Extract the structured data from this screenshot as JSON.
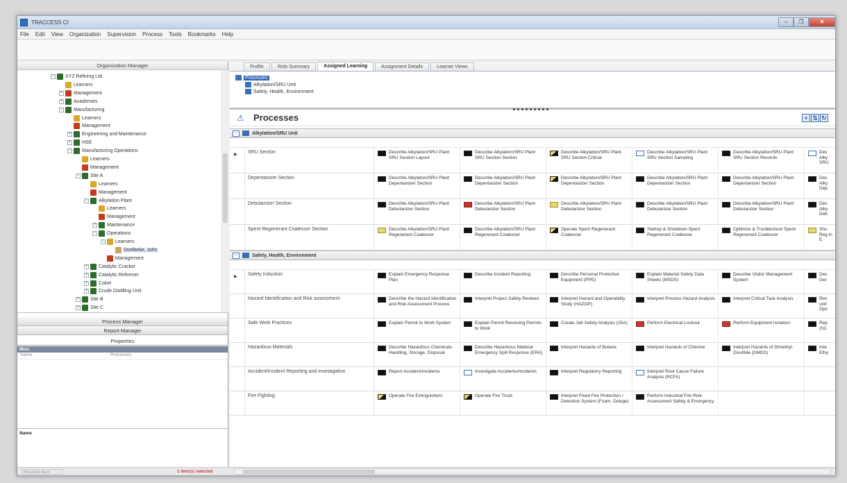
{
  "window": {
    "title": "TRACCESS CI",
    "controls": [
      "–",
      "❐",
      "✕"
    ]
  },
  "menu": [
    "File",
    "Edit",
    "View",
    "Organization",
    "Supervision",
    "Process",
    "Tools",
    "Bookmarks",
    "Help"
  ],
  "left_pane": {
    "header": "Organization Manager",
    "tree": [
      {
        "label": "XYZ Refining Ltd",
        "icon": "org",
        "depth": 0,
        "exp": "−"
      },
      {
        "label": "Learners",
        "icon": "grp",
        "depth": 1,
        "exp": ""
      },
      {
        "label": "Management",
        "icon": "mgr",
        "depth": 1,
        "exp": "+"
      },
      {
        "label": "Academies",
        "icon": "org",
        "depth": 1,
        "exp": "+"
      },
      {
        "label": "Manufacturing",
        "icon": "org",
        "depth": 1,
        "exp": "−"
      },
      {
        "label": "Learners",
        "icon": "grp",
        "depth": 2,
        "exp": ""
      },
      {
        "label": "Management",
        "icon": "mgr",
        "depth": 2,
        "exp": ""
      },
      {
        "label": "Engineering and Maintenance",
        "icon": "org",
        "depth": 2,
        "exp": "+"
      },
      {
        "label": "HSE",
        "icon": "org",
        "depth": 2,
        "exp": "+"
      },
      {
        "label": "Manufacturing Operations",
        "icon": "org",
        "depth": 2,
        "exp": "−"
      },
      {
        "label": "Learners",
        "icon": "grp",
        "depth": 3,
        "exp": ""
      },
      {
        "label": "Management",
        "icon": "mgr",
        "depth": 3,
        "exp": ""
      },
      {
        "label": "Site A",
        "icon": "org",
        "depth": 3,
        "exp": "−"
      },
      {
        "label": "Learners",
        "icon": "grp",
        "depth": 4,
        "exp": ""
      },
      {
        "label": "Management",
        "icon": "mgr",
        "depth": 4,
        "exp": ""
      },
      {
        "label": "Alkylation Plant",
        "icon": "org",
        "depth": 4,
        "exp": "−"
      },
      {
        "label": "Learners",
        "icon": "grp",
        "depth": 5,
        "exp": ""
      },
      {
        "label": "Management",
        "icon": "mgr",
        "depth": 5,
        "exp": ""
      },
      {
        "label": "Maintenance",
        "icon": "org",
        "depth": 5,
        "exp": "+"
      },
      {
        "label": "Operations",
        "icon": "org",
        "depth": 5,
        "exp": "−"
      },
      {
        "label": "Learners",
        "icon": "grp",
        "depth": 6,
        "exp": "−"
      },
      {
        "label": "Doelbeke, John",
        "icon": "user",
        "depth": 7,
        "exp": "",
        "selected": true
      },
      {
        "label": "Management",
        "icon": "mgr",
        "depth": 6,
        "exp": ""
      },
      {
        "label": "Catalytic Cracker",
        "icon": "org",
        "depth": 4,
        "exp": "+"
      },
      {
        "label": "Catalytic Reformer",
        "icon": "org",
        "depth": 4,
        "exp": "+"
      },
      {
        "label": "Coker",
        "icon": "org",
        "depth": 4,
        "exp": "+"
      },
      {
        "label": "Crude Distilling Unit",
        "icon": "org",
        "depth": 4,
        "exp": "+"
      },
      {
        "label": "Site B",
        "icon": "org",
        "depth": 3,
        "exp": "+"
      },
      {
        "label": "Site C",
        "icon": "org",
        "depth": 3,
        "exp": "+"
      }
    ],
    "process_manager": "Process Manager",
    "report_manager": "Report Manager",
    "properties": "Properties",
    "props_section": "Misc",
    "props_row": {
      "name": "Name",
      "value": "Processes"
    },
    "desc_label": "Name",
    "status_left": "Resolve Item",
    "status_right": "1 item(s) selected"
  },
  "tabs": [
    {
      "label": "Profile",
      "active": false
    },
    {
      "label": "Role Summary",
      "active": false
    },
    {
      "label": "Assigned Learning",
      "active": true
    },
    {
      "label": "Assignment Details",
      "active": false
    },
    {
      "label": "Learner Views",
      "active": false
    }
  ],
  "crumb_tree": {
    "root": "Processes",
    "children": [
      "Alkylation/SRU Unit",
      "Safety, Health, Environment"
    ]
  },
  "processes": {
    "title": "Processes",
    "buttons": [
      "+",
      "⇅",
      "↻"
    ],
    "groups": [
      {
        "label": "Alkylation/SRU Unit",
        "rows": [
          {
            "section": "SRU Section",
            "current": true,
            "cells": [
              {
                "ico": "black",
                "text": "Describe Alkylation/SRU Plant SRU Section Layout"
              },
              {
                "ico": "black",
                "text": "Describe Alkylation/SRU Plant SRU Section Section"
              },
              {
                "ico": "flag",
                "text": "Describe Alkylation/SRU Plant SRU Section Critical"
              },
              {
                "ico": "white",
                "text": "Describe Alkylation/SRU Plant SRU Section Sampling"
              },
              {
                "ico": "black",
                "text": "Describe Alkylation/SRU Plant SRU Section Records"
              },
              {
                "ico": "white",
                "text": "Des Alky SRU"
              }
            ]
          },
          {
            "section": "Depentanizer Section",
            "cells": [
              {
                "ico": "black",
                "text": "Describe Alkylation/SRU Plant Depentanizer Section"
              },
              {
                "ico": "black",
                "text": "Describe Alkylation/SRU Plant Depentanizer Section"
              },
              {
                "ico": "flag",
                "text": "Describe Alkylation/SRU Plant Depentanizer Section"
              },
              {
                "ico": "black",
                "text": "Describe Alkylation/SRU Plant Depentanizer Section"
              },
              {
                "ico": "black",
                "text": "Describe Alkylation/SRU Plant Depentanizer Section"
              },
              {
                "ico": "black",
                "text": "Des Alky Dep"
              }
            ]
          },
          {
            "section": "Debutanizer Section",
            "cells": [
              {
                "ico": "black",
                "text": "Describe Alkylation/SRU Plant Debutanizer Section"
              },
              {
                "ico": "red",
                "text": "Describe Alkylation/SRU Plant Debutanizer Section"
              },
              {
                "ico": "yellow",
                "text": "Describe Alkylation/SRU Plant Debutanizer Section"
              },
              {
                "ico": "black",
                "text": "Describe Alkylation/SRU Plant Debutanizer Section"
              },
              {
                "ico": "black",
                "text": "Describe Alkylation/SRU Plant Debutanizer Section"
              },
              {
                "ico": "black",
                "text": "Des Alky Deb"
              }
            ]
          },
          {
            "section": "Spent Regenerant Coalescer Section",
            "cells": [
              {
                "ico": "yellow",
                "text": "Describe Alkylation/SRU Plant Regenerant Coalescer"
              },
              {
                "ico": "black",
                "text": "Describe Alkylation/SRU Plant Regenerant Coalescer"
              },
              {
                "ico": "flag",
                "text": "Operate Spent Regenerant Coalescer"
              },
              {
                "ico": "black",
                "text": "Startup & Shutdown Spent Regenerant Coalescer"
              },
              {
                "ico": "black",
                "text": "Optimize & Troubleshoot Spent Regenerant Coalescer"
              },
              {
                "ico": "yellow",
                "text": "Shu Reg in E"
              }
            ]
          }
        ]
      },
      {
        "label": "Safety, Health, Environment",
        "rows": [
          {
            "section": "Safety Induction",
            "current": true,
            "cells": [
              {
                "ico": "black",
                "text": "Explain Emergency Response Plan"
              },
              {
                "ico": "black",
                "text": "Describe Incident Reporting"
              },
              {
                "ico": "black",
                "text": "Describe Personal Protective Equipment (PPE)"
              },
              {
                "ico": "black",
                "text": "Explain Material Safety Data Sheets (MSDS)"
              },
              {
                "ico": "black",
                "text": "Describe Visitor Management System"
              },
              {
                "ico": "black",
                "text": "Des Ger"
              }
            ]
          },
          {
            "section": "Hazard Identification and Risk assessment",
            "cells": [
              {
                "ico": "black",
                "text": "Describe the Hazard Identification and Risk Assessment Process"
              },
              {
                "ico": "black",
                "text": "Interpret Project Safety Reviews"
              },
              {
                "ico": "black",
                "text": "Interpret Hazard and Operability Study (HAZOP)"
              },
              {
                "ico": "black",
                "text": "Interpret Process Hazard Analysis"
              },
              {
                "ico": "black",
                "text": "Interpret Critical Task Analysis"
              },
              {
                "ico": "black",
                "text": "Rev unit Ops"
              }
            ]
          },
          {
            "section": "Safe Work Practices",
            "cells": [
              {
                "ico": "black",
                "text": "Explain Permit to Work System"
              },
              {
                "ico": "black",
                "text": "Explain Permit Receiving Permits to Work"
              },
              {
                "ico": "black",
                "text": "Create Job Safety Analysis (JSA)"
              },
              {
                "ico": "red",
                "text": "Perform Electrical Lockout"
              },
              {
                "ico": "red",
                "text": "Perform Equipment Isolation"
              },
              {
                "ico": "black",
                "text": "Rep (SC"
              }
            ]
          },
          {
            "section": "Hazardous Materials",
            "cells": [
              {
                "ico": "black",
                "text": "Describe Hazardous Chemicals Handling, Storage, Disposal"
              },
              {
                "ico": "black",
                "text": "Describe Hazardous Material Emergency Spill Response (ERA)"
              },
              {
                "ico": "black",
                "text": "Interpret Hazards of Butane"
              },
              {
                "ico": "black",
                "text": "Interpret Hazards of Chlorine"
              },
              {
                "ico": "black",
                "text": "Interpret Hazards of Dimethyl-Disulfide (DMDS)"
              },
              {
                "ico": "black",
                "text": "Inte Ethy"
              }
            ]
          },
          {
            "section": "Accident/Incident Reporting and Investigation",
            "cells": [
              {
                "ico": "black",
                "text": "Report Accident/Incidents"
              },
              {
                "ico": "white",
                "text": "Investigate Accidents/Incidents"
              },
              {
                "ico": "black",
                "text": "Interpret Regulatory Reporting"
              },
              {
                "ico": "white",
                "text": "Interpret Root Cause Failure Analysis (RCFA)"
              },
              {
                "ico": "",
                "text": ""
              },
              {
                "ico": "",
                "text": ""
              }
            ]
          },
          {
            "section": "Fire Fighting",
            "cells": [
              {
                "ico": "flag",
                "text": "Operate Fire Extinguishers"
              },
              {
                "ico": "flag",
                "text": "Operate Fire Truck"
              },
              {
                "ico": "black",
                "text": "Interpret Fixed Fire Protection / Detection System (Foam, Deluge)"
              },
              {
                "ico": "black",
                "text": "Perform Industrial Fire Risk Assessment Safety & Emergency"
              },
              {
                "ico": "",
                "text": ""
              },
              {
                "ico": "",
                "text": ""
              }
            ]
          }
        ]
      }
    ]
  }
}
